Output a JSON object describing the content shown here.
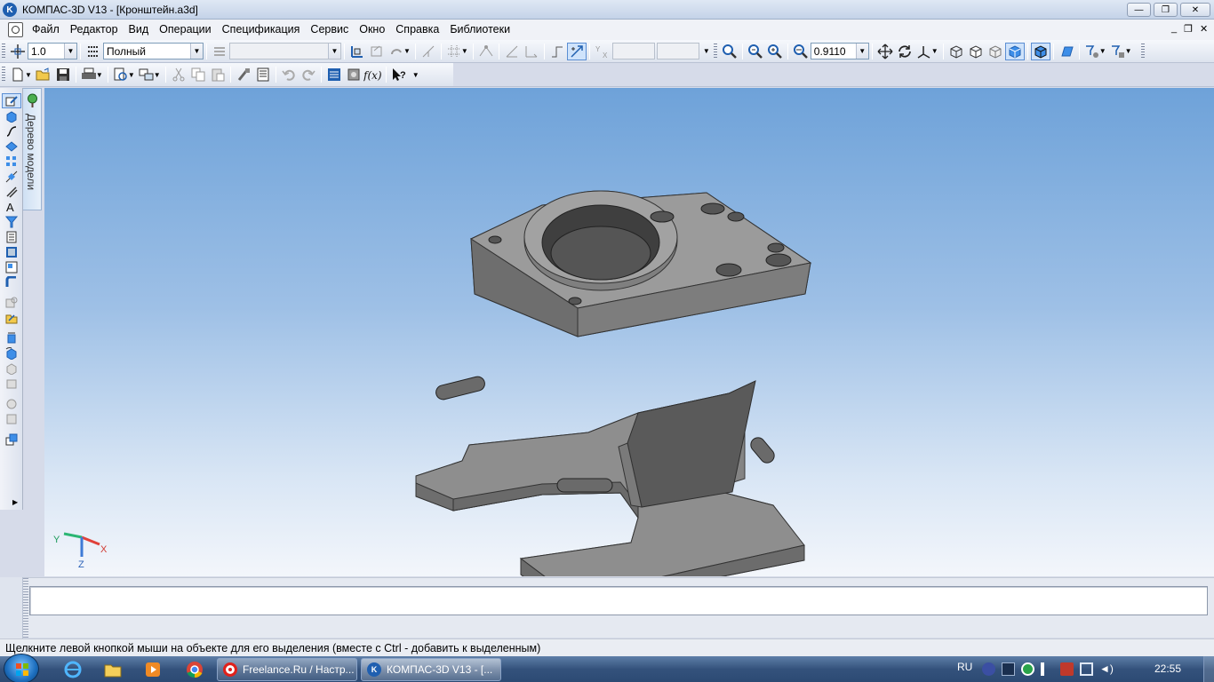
{
  "window": {
    "title": "КОМПАС-3D V13 - [Кронштейн.a3d]",
    "minimize": "—",
    "maximize": "❐",
    "close": "✕",
    "doc_minimize": "_",
    "doc_restore": "❐",
    "doc_close": "✕"
  },
  "menu": [
    "Файл",
    "Редактор",
    "Вид",
    "Операции",
    "Спецификация",
    "Сервис",
    "Окно",
    "Справка",
    "Библиотеки"
  ],
  "toolbar": {
    "step_value": "1.0",
    "view_mode": "Полный",
    "style_placeholder": "",
    "coord_x": "",
    "coord_y": "",
    "zoom_value": "0.9110",
    "accent_color": "#3d8ee8"
  },
  "left_panel": {
    "tree_tab_label": "Дерево модели"
  },
  "viewport": {
    "axis_x": "X",
    "axis_y": "Y",
    "axis_z": "Z",
    "part_color": "#8a8a8a"
  },
  "status": {
    "hint": "Щелкните левой кнопкой мыши на объекте для его выделения (вместе с Ctrl - добавить к выделенным)"
  },
  "taskbar": {
    "tasks": [
      {
        "label": "Freelance.Ru / Настр...",
        "icon": "opera-icon"
      },
      {
        "label": "КОМПАС-3D V13 - [...",
        "icon": "kompas-icon"
      }
    ],
    "lang": "RU",
    "clock": "22:55"
  }
}
